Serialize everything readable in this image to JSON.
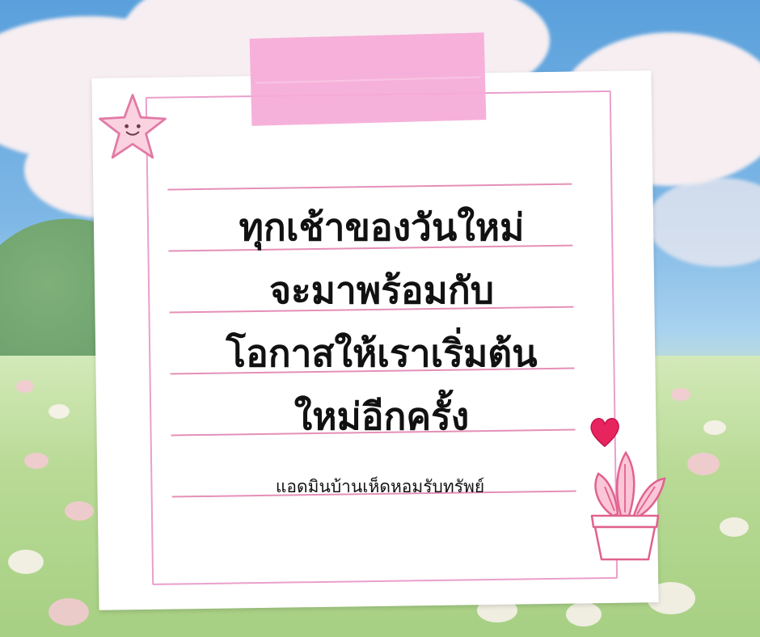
{
  "quote": {
    "lines": [
      "ทุกเช้าของวันใหม่",
      "จะมาพร้อมกับ",
      "โอกาสให้เราเริ่มต้น",
      "ใหม่อีกครั้ง"
    ]
  },
  "credit": "แอดมินบ้านเห็ดหอมรับทรัพย์",
  "colors": {
    "note_border": "#ea9fcc",
    "tape": "#f5aad7",
    "rule": "#e58fb8",
    "text": "#111111"
  },
  "icons": [
    "star-icon",
    "heart-icon",
    "potted-plant-icon"
  ]
}
